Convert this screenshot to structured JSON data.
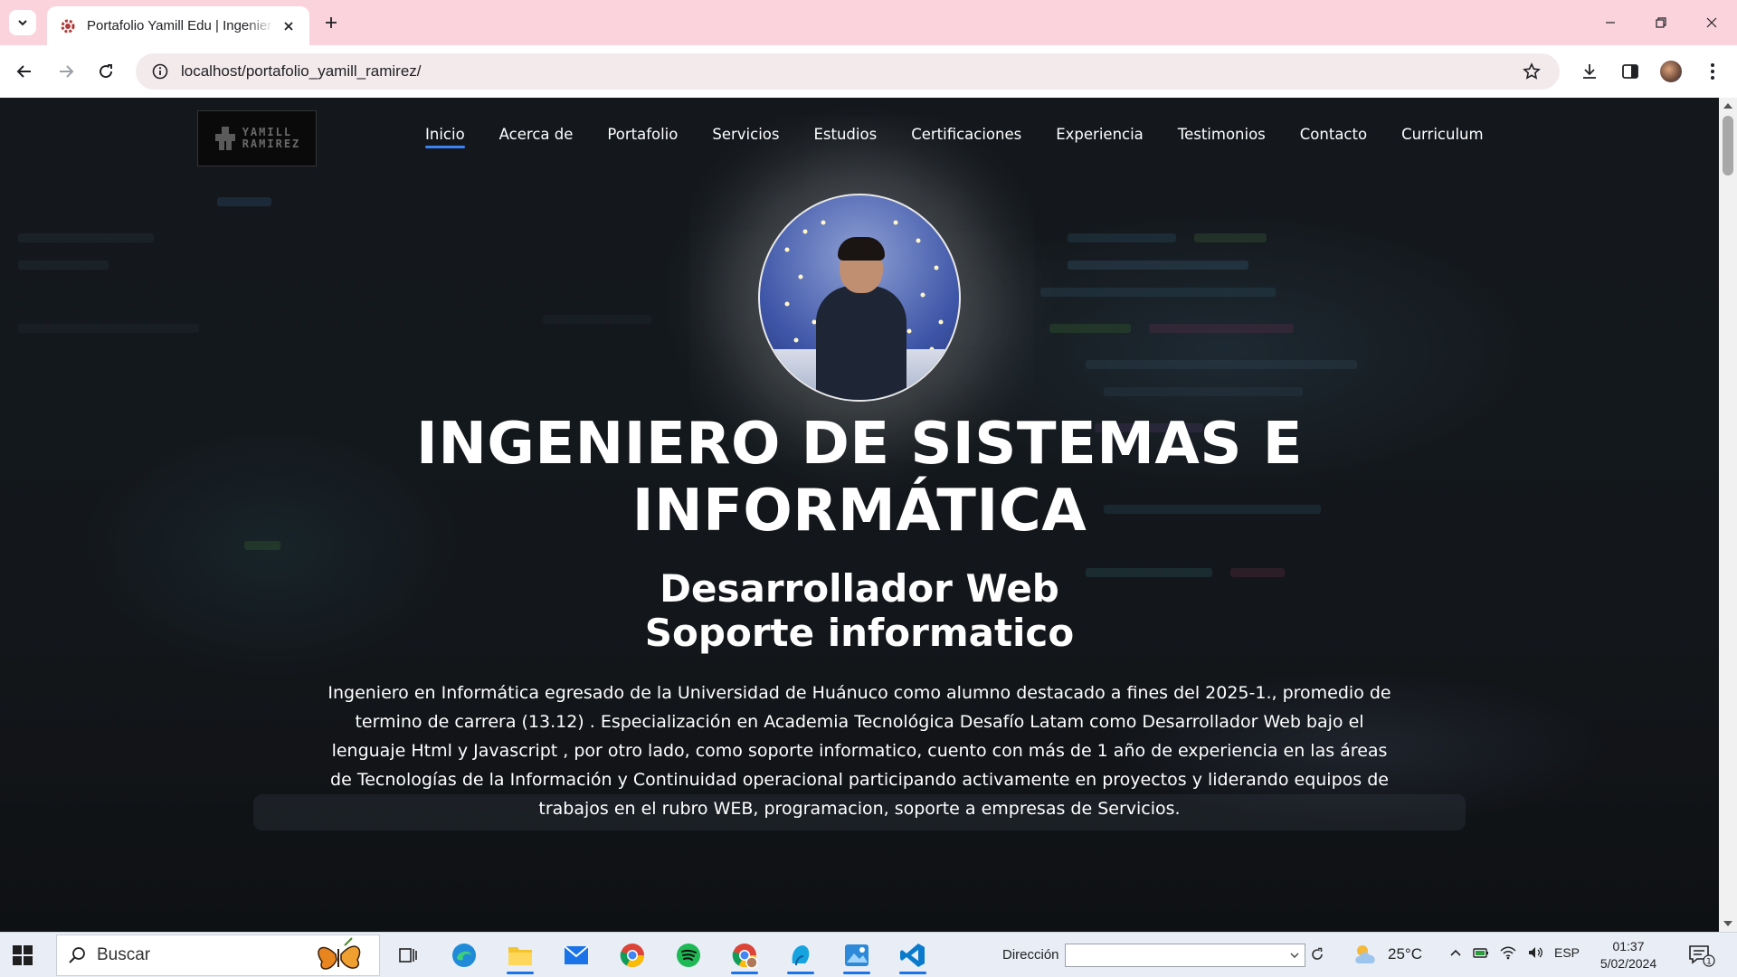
{
  "browser": {
    "tab_title": "Portafolio Yamill Edu | Ingeniero de Sistemas",
    "url": "localhost/portafolio_yamill_ramirez/"
  },
  "page": {
    "logo_text": [
      "YAMILL",
      "RAMIREZ"
    ],
    "nav": [
      "Inicio",
      "Acerca de",
      "Portafolio",
      "Servicios",
      "Estudios",
      "Certificaciones",
      "Experiencia",
      "Testimonios",
      "Contacto",
      "Curriculum"
    ],
    "active_nav": "Inicio",
    "headline_line1": "INGENIERO DE SISTEMAS E",
    "headline_line2": "INFORMÁTICA",
    "subhead_line1": "Desarrollador Web",
    "subhead_line2": "Soporte informatico",
    "bio": "Ingeniero en Informática egresado de la Universidad de Huánuco como alumno destacado a fines del 2025-1., promedio de termino de carrera (13.12) . Especialización en Academia Tecnológica Desafío Latam como Desarrollador Web bajo el lenguaje Html y Javascript , por otro lado, como soporte informatico, cuento con más de 1 año de experiencia en las áreas de Tecnologías de la Información y Continuidad operacional participando activamente en proyectos y liderando equipos de trabajos en el rubro WEB, programacion, soporte a empresas de Servicios."
  },
  "taskbar": {
    "search_placeholder": "Buscar",
    "address_label": "Dirección",
    "temperature": "25°C",
    "language": "ESP",
    "time": "01:37",
    "date": "5/02/2024",
    "notification_count": "1"
  },
  "colors": {
    "tabbar_bg": "#fbd3dd",
    "nav_active_underline": "#3b82f6"
  }
}
